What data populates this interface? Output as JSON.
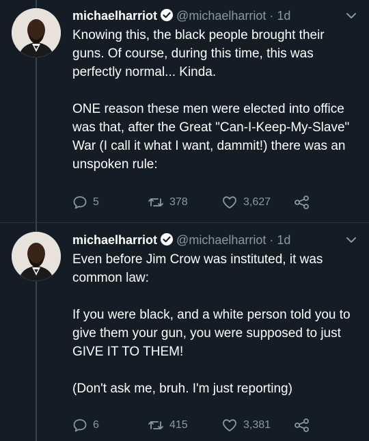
{
  "tweets": [
    {
      "author_name": "michaelharriot",
      "handle": "@michaelharriot",
      "time": "· 1d",
      "text": "Knowing this, the black people brought their guns. Of course, during this time, this was perfectly normal... Kinda.\n\nONE reason these men were elected into office was that, after the Great \"Can-I-Keep-My-Slave\" War (I call it what I want, dammit!) there was an unspoken rule:",
      "replies": "5",
      "retweets": "378",
      "likes": "3,627"
    },
    {
      "author_name": "michaelharriot",
      "handle": "@michaelharriot",
      "time": "· 1d",
      "text": "Even before Jim Crow was instituted, it was common law:\n\nIf you were black, and a white person told you to give them your gun, you were supposed to just GIVE IT TO THEM!\n\n(Don't ask me, bruh. I'm just reporting)",
      "replies": "6",
      "retweets": "415",
      "likes": "3,381"
    }
  ],
  "colors": {
    "background": "#141d26",
    "secondary_text": "#8899a6",
    "verified": "#ffffff"
  },
  "icons": [
    "verified-badge-icon",
    "chevron-down-icon",
    "reply-icon",
    "retweet-icon",
    "like-icon",
    "share-icon"
  ]
}
